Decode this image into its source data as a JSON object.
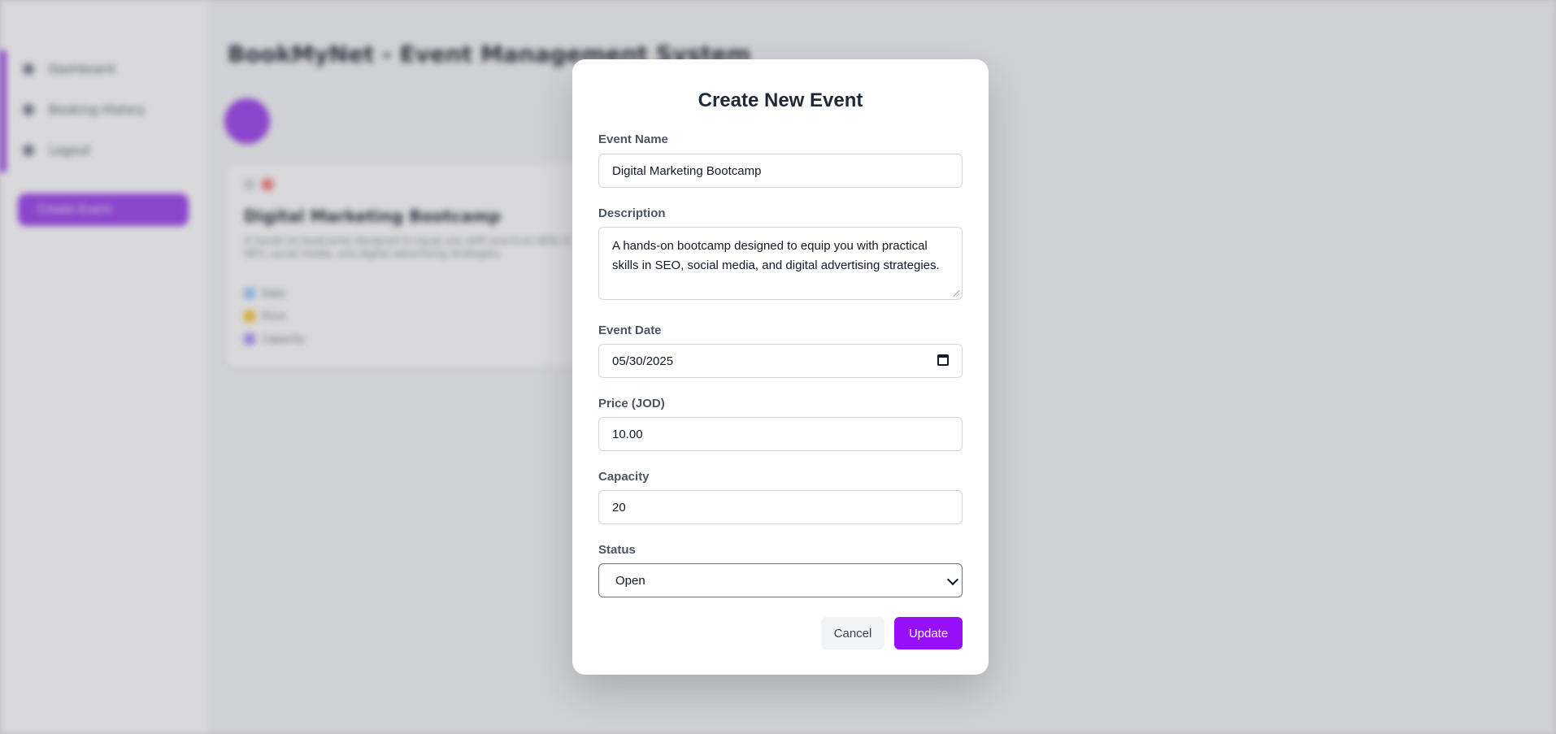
{
  "background": {
    "app_title": "BookMyNet - Event Management System",
    "sidebar": {
      "items": [
        {
          "label": "Dashboard",
          "icon": "home-icon"
        },
        {
          "label": "Booking History",
          "icon": "history-icon"
        },
        {
          "label": "Logout",
          "icon": "logout-icon"
        }
      ],
      "button_label": "Create Event"
    },
    "card": {
      "title": "Digital Marketing Bootcamp",
      "description": "A hands-on bootcamp designed to equip you with practical skills in SEO, social media, and digital advertising strategies.",
      "rows": [
        "Date",
        "Price",
        "Capacity"
      ]
    }
  },
  "modal": {
    "title": "Create New Event",
    "fields": {
      "event_name": {
        "label": "Event Name",
        "value": "Digital Marketing Bootcamp"
      },
      "description": {
        "label": "Description",
        "value": "A hands-on bootcamp designed to equip you with practical skills in SEO, social media, and digital advertising strategies."
      },
      "event_date": {
        "label": "Event Date",
        "value": "05/30/2025"
      },
      "price": {
        "label": "Price (JOD)",
        "value": "10.00"
      },
      "capacity": {
        "label": "Capacity",
        "value": "20"
      },
      "status": {
        "label": "Status",
        "value": "Open"
      }
    },
    "buttons": {
      "cancel": "Cancel",
      "update": "Update"
    }
  },
  "colors": {
    "accent": "#9810fa",
    "backdrop": "#d6d6d8"
  }
}
